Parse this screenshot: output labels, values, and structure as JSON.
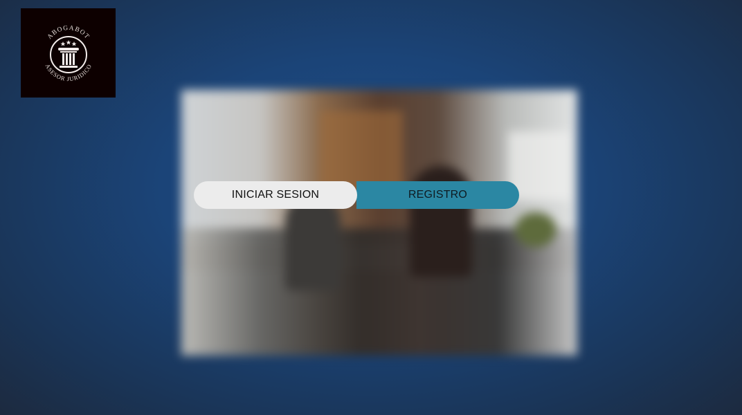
{
  "logo": {
    "brand_top": "ABOGABOT",
    "brand_bottom": "ASESOR JURIDICO",
    "icon": "pillar-icon"
  },
  "auth": {
    "login_label": "INICIAR SESION",
    "register_label": "REGISTRO"
  },
  "colors": {
    "background": "#1c3f6e",
    "logo_bg": "#0d0000",
    "login_button": "#ececec",
    "register_button": "#2b87a3"
  }
}
